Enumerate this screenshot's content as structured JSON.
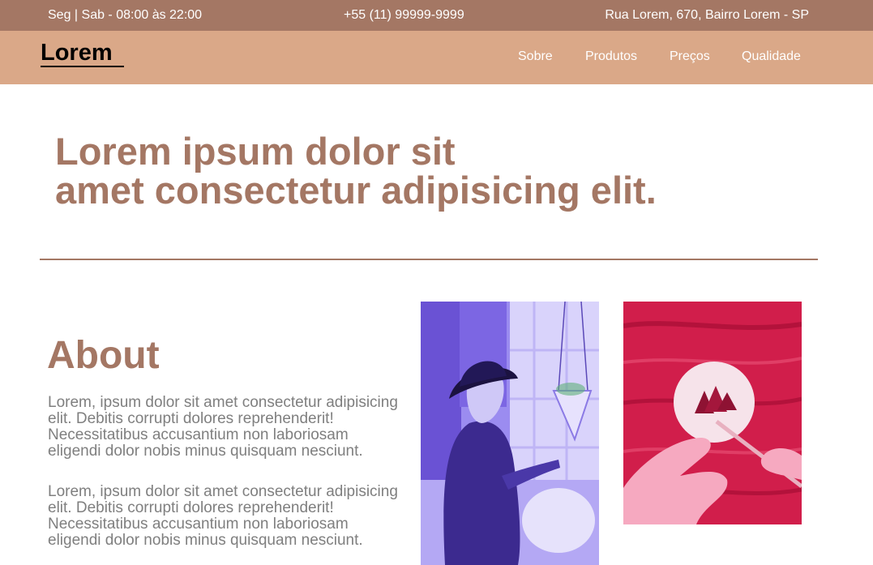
{
  "topbar": {
    "hours": "Seg | Sab - 08:00 às 22:00",
    "phone": "+55 (11) 99999-9999",
    "address": "Rua Lorem, 670, Bairro Lorem - SP"
  },
  "navbar": {
    "logo": "Lorem",
    "links": [
      "Sobre",
      "Produtos",
      "Preços",
      "Qualidade"
    ]
  },
  "hero": {
    "line1": "Lorem ipsum dolor sit",
    "line2": "amet consectetur adipisicing elit."
  },
  "about": {
    "heading": "About",
    "paragraphs": [
      "Lorem, ipsum dolor sit amet consectetur adipisicing elit. Debitis corrupti dolores reprehenderit! Necessitatibus accusantium non laboriosam eligendi dolor nobis minus quisquam nesciunt.",
      "Lorem, ipsum dolor sit amet consectetur adipisicing elit. Debitis corrupti dolores reprehenderit! Necessitatibus accusantium non laboriosam eligendi dolor nobis minus quisquam nesciunt."
    ]
  },
  "images": [
    {
      "name": "woman-in-hat-photo",
      "tint": "#8f7ce6"
    },
    {
      "name": "hands-painting-photo",
      "tint": "#d11e4b"
    }
  ],
  "colors": {
    "topbar": "#a47764",
    "navbar": "#daa888",
    "accent": "#a47764",
    "body_text": "#7f7f7f"
  }
}
